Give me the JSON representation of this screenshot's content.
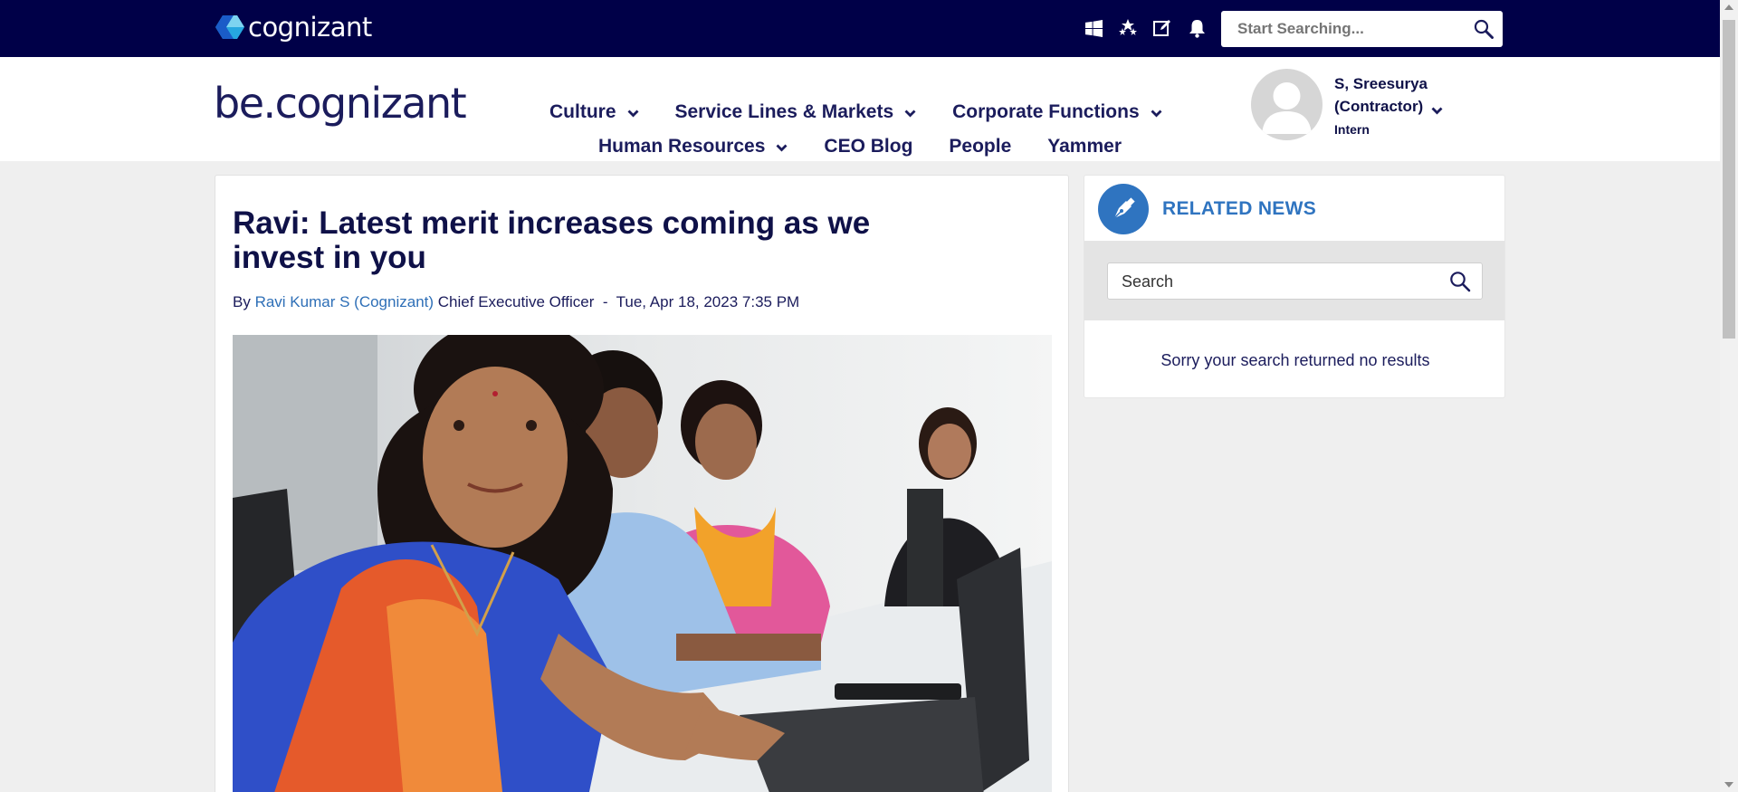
{
  "topbar": {
    "logo_text": "cognizant",
    "search_placeholder": "Start Searching...",
    "icons": [
      "windows-icon",
      "stars-icon",
      "edit-icon",
      "bell-icon",
      "search-icon"
    ]
  },
  "header": {
    "brand": "be.cognizant",
    "nav": [
      {
        "label": "Culture",
        "has_dropdown": true
      },
      {
        "label": "Service Lines & Markets",
        "has_dropdown": true
      },
      {
        "label": "Corporate Functions",
        "has_dropdown": true
      },
      {
        "label": "Human Resources",
        "has_dropdown": true
      },
      {
        "label": "CEO Blog",
        "has_dropdown": false
      },
      {
        "label": "People",
        "has_dropdown": false
      },
      {
        "label": "Yammer",
        "has_dropdown": false
      }
    ],
    "user": {
      "name": "S, Sreesurya (Contractor)",
      "role": "Intern"
    }
  },
  "article": {
    "title": "Ravi: Latest merit increases coming as we invest in you",
    "byline": {
      "prefix": "By",
      "author": "Ravi Kumar S (Cognizant)",
      "position": "Chief Executive Officer",
      "separator": "-",
      "date": "Tue, Apr 18, 2023 7:35 PM"
    }
  },
  "related": {
    "title": "RELATED NEWS",
    "search_placeholder": "Search",
    "empty_message": "Sorry your search returned no results"
  },
  "colors": {
    "topbar_bg": "#000048",
    "accent_blue": "#2f74c0",
    "text_navy": "#0f1148",
    "page_bg": "#efefef"
  }
}
